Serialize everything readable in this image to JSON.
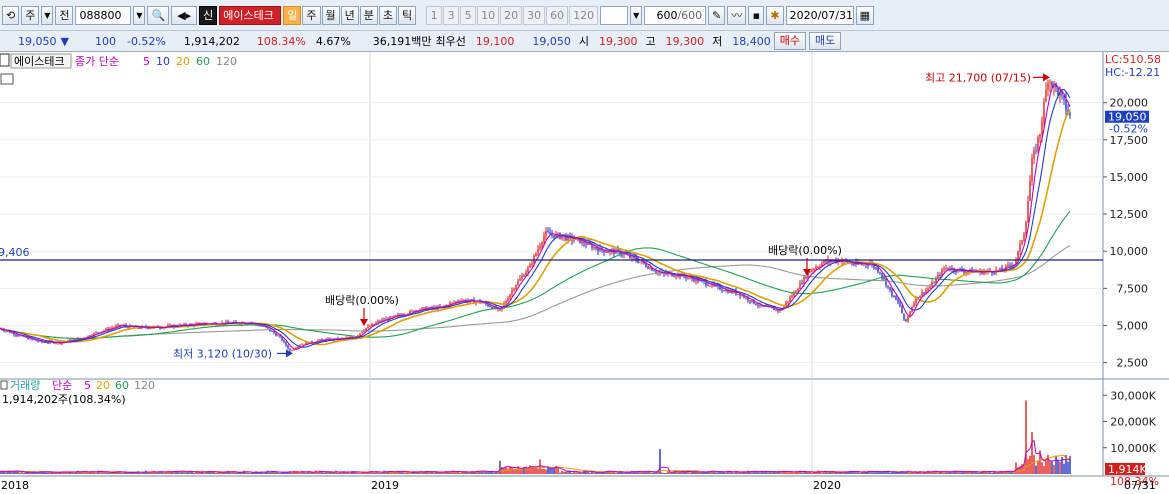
{
  "toolbar": {
    "market_btn": "주",
    "prev_btn": "전",
    "code": "088800",
    "stock_name": "에이스테크",
    "shin_badge": "신",
    "periods": [
      "일",
      "주",
      "월",
      "년",
      "분",
      "초",
      "틱"
    ],
    "selected_period": "일",
    "minutes": [
      "1",
      "3",
      "5",
      "10",
      "20",
      "30",
      "60",
      "120"
    ],
    "count": "600",
    "count_total": "/600",
    "date": "2020/07/31"
  },
  "quote": {
    "price": "19,050",
    "arrow": "▼",
    "change": "100",
    "change_rate": "-0.52%",
    "volume": "1,914,202",
    "volume_ratio": "108.34%",
    "turnover": "4.67%",
    "trade_amount": "36,191백만",
    "best_label": "최우선",
    "best_ask": "19,100",
    "best_bid": "19,050",
    "open_label": "시",
    "open": "19,300",
    "high_label": "고",
    "high": "19,300",
    "low_label": "저",
    "low": "18,400",
    "buy_btn": "매수",
    "sell_btn": "매도"
  },
  "chart_data": {
    "type": "candlestick",
    "price_panel": {
      "legend": {
        "name": "에이스테크",
        "ma_label": "종가 단순",
        "ma_periods": [
          "5",
          "10",
          "20",
          "60",
          "120"
        ],
        "ma_colors": [
          "#c000c0",
          "#1f3fbf",
          "#e0a000",
          "#20a050",
          "#888888"
        ]
      },
      "lc": "LC:510.58",
      "hc": "HC:-12.21",
      "y_ticks": [
        2500,
        5000,
        7500,
        10000,
        12500,
        15000,
        17500,
        20000
      ],
      "y_tick_labels": [
        "2,500",
        "5,000",
        "7,500",
        "10,000",
        "12,500",
        "15,000",
        "17,500",
        "20,000"
      ],
      "ylim": [
        1600,
        22600
      ],
      "current_price_label": "19,050",
      "current_change_label": "-0.52%",
      "current_price": 19050,
      "hline_value": 9406,
      "hline_label": "9,406",
      "annotations": {
        "high_label": "최고 21,700 (07/15)",
        "high_value": 21700,
        "low_label": "최저 3,120 (10/30)",
        "low_value": 3120,
        "dividend1": "배당락(0.00%)",
        "dividend2": "배당락(0.00%)"
      },
      "close_series": [
        [
          0,
          4800
        ],
        [
          20,
          4300
        ],
        [
          40,
          3900
        ],
        [
          60,
          3850
        ],
        [
          80,
          4100
        ],
        [
          100,
          4600
        ],
        [
          120,
          5000
        ],
        [
          140,
          4850
        ],
        [
          160,
          4900
        ],
        [
          180,
          5000
        ],
        [
          200,
          5100
        ],
        [
          220,
          5150
        ],
        [
          250,
          5200
        ],
        [
          265,
          4900
        ],
        [
          280,
          4200
        ],
        [
          290,
          3300
        ],
        [
          300,
          3700
        ],
        [
          320,
          4000
        ],
        [
          340,
          4100
        ],
        [
          355,
          4200
        ],
        [
          365,
          4800
        ],
        [
          380,
          5300
        ],
        [
          400,
          5700
        ],
        [
          420,
          6100
        ],
        [
          440,
          6200
        ],
        [
          460,
          6700
        ],
        [
          480,
          6600
        ],
        [
          500,
          6000
        ],
        [
          515,
          7700
        ],
        [
          530,
          9000
        ],
        [
          545,
          11200
        ],
        [
          560,
          11000
        ],
        [
          580,
          10700
        ],
        [
          600,
          10100
        ],
        [
          620,
          9900
        ],
        [
          640,
          9300
        ],
        [
          660,
          8500
        ],
        [
          680,
          8400
        ],
        [
          700,
          8000
        ],
        [
          720,
          7500
        ],
        [
          740,
          7100
        ],
        [
          760,
          6300
        ],
        [
          780,
          6000
        ],
        [
          795,
          7300
        ],
        [
          810,
          8700
        ],
        [
          825,
          9300
        ],
        [
          840,
          9400
        ],
        [
          855,
          9100
        ],
        [
          870,
          9200
        ],
        [
          880,
          8600
        ],
        [
          890,
          7300
        ],
        [
          900,
          6300
        ],
        [
          905,
          5100
        ],
        [
          915,
          6800
        ],
        [
          930,
          7600
        ],
        [
          945,
          8900
        ],
        [
          960,
          8700
        ],
        [
          980,
          8600
        ],
        [
          1000,
          8700
        ],
        [
          1015,
          9200
        ],
        [
          1025,
          11500
        ],
        [
          1032,
          16000
        ],
        [
          1040,
          18000
        ],
        [
          1048,
          21700
        ],
        [
          1060,
          20500
        ],
        [
          1070,
          19050
        ]
      ]
    },
    "volume_panel": {
      "legend": {
        "name": "거래량",
        "ma_label": "단순",
        "ma_periods": [
          "5",
          "20",
          "60",
          "120"
        ],
        "ma_colors": [
          "#c000c0",
          "#e0a000",
          "#20a050",
          "#888888"
        ]
      },
      "value_label": "1,914,202주(108.34%)",
      "y_ticks": [
        10000,
        20000,
        30000
      ],
      "y_tick_labels": [
        "10,000K",
        "20,000K",
        "30,000K"
      ],
      "ylim": [
        0,
        32000
      ],
      "current_label": "1,914K",
      "current_ratio": "108.34%",
      "current_value": 1914,
      "spikes": [
        [
          660,
          9500
        ],
        [
          1026,
          28000
        ],
        [
          1032,
          16000
        ],
        [
          1040,
          9000
        ],
        [
          500,
          5000
        ],
        [
          540,
          5500
        ]
      ]
    },
    "x_labels": [
      {
        "x": 0,
        "text": "2018"
      },
      {
        "x": 370,
        "text": "2019"
      },
      {
        "x": 812,
        "text": "2020"
      }
    ],
    "x_end_label": "07/31"
  }
}
